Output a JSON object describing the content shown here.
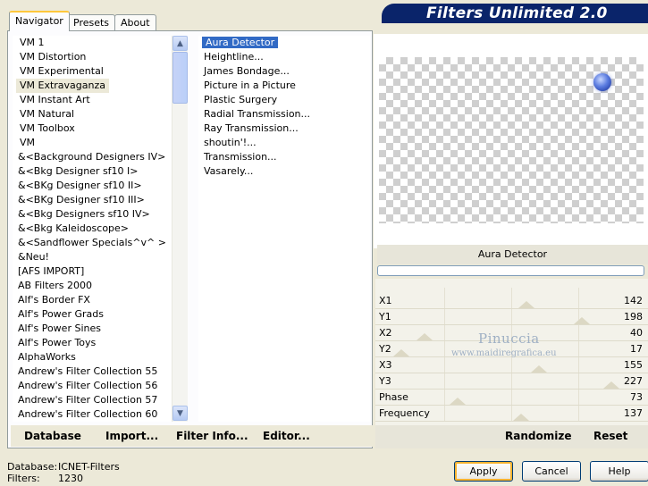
{
  "tabs": [
    {
      "label": "Navigator",
      "active": true
    },
    {
      "label": "Presets",
      "active": false
    },
    {
      "label": "About",
      "active": false
    }
  ],
  "banner_title": "Filters Unlimited 2.0",
  "categories": {
    "selected_index": 3,
    "items": [
      "VM 1",
      "VM Distortion",
      "VM Experimental",
      "VM Extravaganza",
      "VM Instant Art",
      "VM Natural",
      "VM Toolbox",
      "VM",
      "&<Background Designers IV>",
      "&<Bkg Designer sf10 I>",
      "&<BKg Designer sf10 II>",
      "&<BKg Designer sf10 III>",
      "&<Bkg Designers sf10 IV>",
      "&<Bkg Kaleidoscope>",
      "&<Sandflower Specials^v^ >",
      "&Neu!",
      "[AFS IMPORT]",
      "AB Filters 2000",
      "Alf's Border FX",
      "Alf's Power Grads",
      "Alf's Power Sines",
      "Alf's Power Toys",
      "AlphaWorks",
      "Andrew's Filter Collection 55",
      "Andrew's Filter Collection 56",
      "Andrew's Filter Collection 57",
      "Andrew's Filter Collection 60"
    ]
  },
  "filters": {
    "selected_index": 0,
    "items": [
      "Aura Detector",
      "Heightline...",
      "James Bondage...",
      "Picture in a Picture",
      "Plastic Surgery",
      "Radial Transmission...",
      "Ray Transmission...",
      "shoutin'!...",
      "Transmission...",
      "Vasarely..."
    ]
  },
  "bottom_links": {
    "database": "Database",
    "import": "Import...",
    "filter_info": "Filter Info...",
    "editor": "Editor..."
  },
  "current_filter": "Aura Detector",
  "parameters": [
    {
      "label": "X1",
      "value": 142
    },
    {
      "label": "Y1",
      "value": 198
    },
    {
      "label": "X2",
      "value": 40
    },
    {
      "label": "Y2",
      "value": 17
    },
    {
      "label": "X3",
      "value": 155
    },
    {
      "label": "Y3",
      "value": 227
    },
    {
      "label": "Phase",
      "value": 73
    },
    {
      "label": "Frequency",
      "value": 137
    }
  ],
  "watermark": {
    "name": "Pinuccia",
    "site": "www.maidiregrafica.eu"
  },
  "randomize_label": "Randomize",
  "reset_label": "Reset",
  "status": {
    "database_label": "Database:",
    "database_value": "ICNET-Filters",
    "filters_label": "Filters:",
    "filters_value": "1230"
  },
  "buttons": {
    "apply": "Apply",
    "cancel": "Cancel",
    "help": "Help"
  }
}
